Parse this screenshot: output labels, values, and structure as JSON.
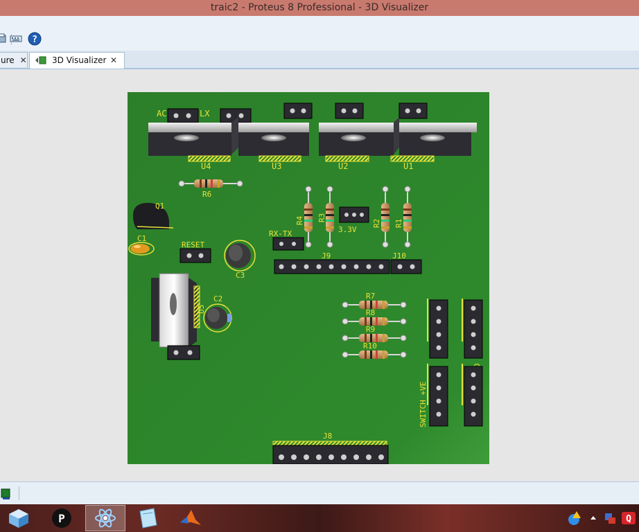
{
  "window": {
    "title": "traic2 - Proteus 8 Professional - 3D Visualizer"
  },
  "tabs": [
    {
      "label": "ure"
    },
    {
      "label": "3D Visualizer"
    }
  ],
  "pcb": {
    "labels": {
      "ac": "AC",
      "lx": "LX",
      "u4": "U4",
      "u3": "U3",
      "u2": "U2",
      "u1": "U1",
      "r6": "R6",
      "r4": "R4",
      "r3": "R3",
      "r2": "R2",
      "r1": "R1",
      "q1": "Q1",
      "c1": "C1",
      "reset": "RESET",
      "rxtx": "RX-TX",
      "v33": "3.3V",
      "c3": "C3",
      "j9": "J9",
      "j10": "J10",
      "u5": "U5",
      "c2": "C2",
      "r7": "R7",
      "r8": "R8",
      "r9": "R9",
      "r10": "R10",
      "switch": "SWITCH_+VE",
      "d": "D",
      "j8": "J8"
    }
  },
  "colors": {
    "board": "#2f8a2c",
    "silk": "#e8e13a",
    "titlebar": "#c97a6f"
  }
}
